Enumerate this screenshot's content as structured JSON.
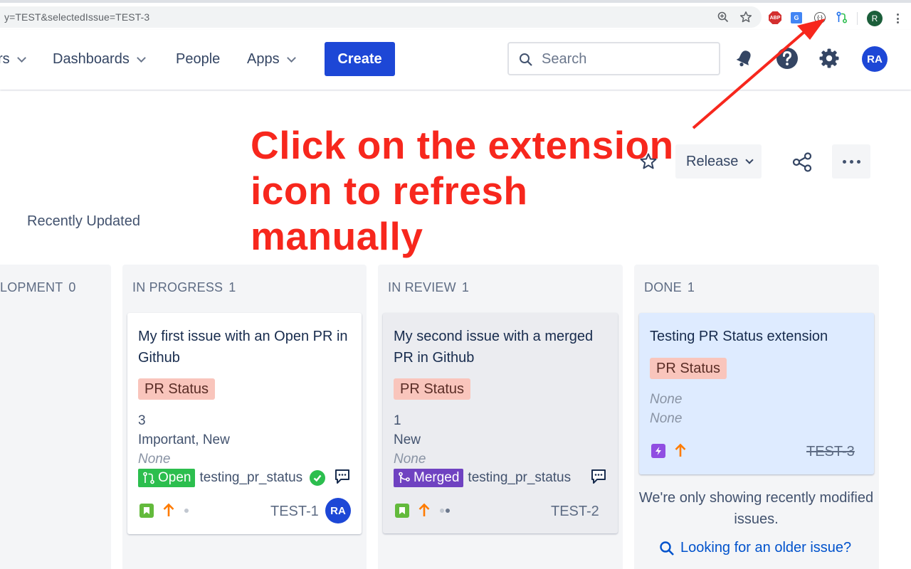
{
  "browser": {
    "url": "y=TEST&selectedIssue=TEST-3",
    "profile_initial": "R",
    "extensions": {
      "abp": "ABP",
      "translate": "G",
      "circle": "{·}"
    }
  },
  "topnav": {
    "partial_item": "rs",
    "dashboards": "Dashboards",
    "people": "People",
    "apps": "Apps",
    "create": "Create",
    "search_placeholder": "Search",
    "avatar": "RA"
  },
  "annotation": {
    "line1": "Click on the extension",
    "line2": "icon to refresh manually"
  },
  "board": {
    "release": "Release",
    "recently_updated": "Recently Updated",
    "note": "We're only showing recently modified issues.",
    "older_link": "Looking for an older issue?"
  },
  "columns": [
    {
      "title": "LOPMENT",
      "count": "0"
    },
    {
      "title": "IN PROGRESS",
      "count": "1",
      "card": {
        "title": "My first issue with an Open PR in Github",
        "label": "PR Status",
        "field1": "3",
        "field2": "Important, New",
        "field3": "None",
        "pr_state": "Open",
        "repo": "testing_pr_status",
        "key": "TEST-1",
        "assignee": "RA"
      }
    },
    {
      "title": "IN REVIEW",
      "count": "1",
      "card": {
        "title": "My second issue with a merged PR in Github",
        "label": "PR Status",
        "field1": "1",
        "field2": "New",
        "field3": "None",
        "pr_state": "Merged",
        "repo": "testing_pr_status",
        "key": "TEST-2"
      }
    },
    {
      "title": "DONE",
      "count": "1",
      "card": {
        "title": "Testing PR Status extension",
        "label": "PR Status",
        "field1": "None",
        "field2": "None",
        "key": "TEST-3"
      }
    }
  ],
  "colors": {
    "primary": "#1d47d6",
    "annotation": "#f7271d",
    "open": "#2cbe4e",
    "merged": "#6f42c1",
    "label_bg": "#f9c5bc",
    "done_card": "#deebff"
  }
}
